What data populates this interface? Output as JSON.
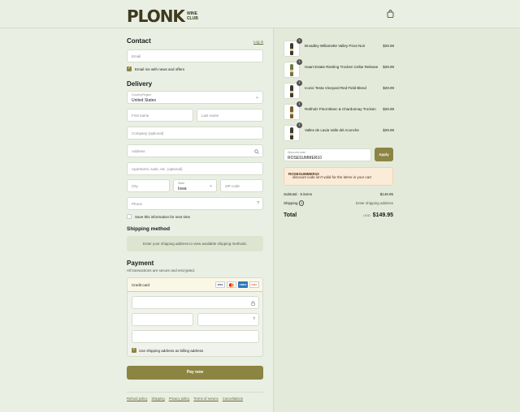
{
  "brand": {
    "logo_text": "PLONK",
    "logo_sub_line1": "WINE",
    "logo_sub_line2": "CLUB"
  },
  "contact": {
    "title": "Contact",
    "login_link": "Log in",
    "email_placeholder": "Email",
    "newsletter_label": "Email me with news and offers",
    "newsletter_checked": true
  },
  "delivery": {
    "title": "Delivery",
    "country_label": "Country/Region",
    "country_value": "United States",
    "first_name_placeholder": "First name",
    "last_name_placeholder": "Last name",
    "company_placeholder": "Company (optional)",
    "address_placeholder": "Address",
    "apartment_placeholder": "Apartment, suite, etc. (optional)",
    "city_placeholder": "City",
    "state_label": "State",
    "state_value": "Iowa",
    "zip_placeholder": "ZIP code",
    "phone_placeholder": "Phone",
    "save_info_label": "Save this information for next time",
    "save_info_checked": false
  },
  "shipping_method": {
    "title": "Shipping method",
    "message": "Enter your shipping address to view available shipping methods."
  },
  "payment": {
    "title": "Payment",
    "subtitle": "All transactions are secure and encrypted.",
    "method_label": "Credit card",
    "cards": [
      "VISA",
      "MC",
      "AMEX",
      "DISC"
    ],
    "billing_label": "Use shipping address as billing address",
    "billing_checked": true
  },
  "pay_button": "Pay now",
  "footer_links": [
    "Refund policy",
    "Shipping",
    "Privacy policy",
    "Terms of service",
    "Cancellations"
  ],
  "cart": {
    "items": [
      {
        "qty": "1",
        "name": "Broadley Willamette Valley Pinot Noir",
        "price": "$29.99"
      },
      {
        "qty": "1",
        "name": "Haart Estate Riesling Trocken Cellar Release",
        "price": "$29.99"
      },
      {
        "qty": "1",
        "name": "Iconic Testa Vineyard Red Field Blend",
        "price": "$29.99"
      },
      {
        "qty": "1",
        "name": "Rebholz Pinot Blanc & Chardonnay Trocken",
        "price": "$29.99"
      },
      {
        "qty": "1",
        "name": "Valles de Lavia Valle del Aconche",
        "price": "$29.99"
      }
    ],
    "discount_label": "Discount code",
    "discount_value": "ROSESUMMER10",
    "apply_label": "Apply",
    "warning_code": "ROSESUMMER10",
    "warning_text": " discount code isn't valid for the items in your cart",
    "subtotal_label": "Subtotal · 5 items",
    "subtotal_value": "$149.95",
    "shipping_label": "Shipping",
    "shipping_value": "Enter shipping address",
    "total_label": "Total",
    "total_currency": "USD",
    "total_value": "$149.95"
  },
  "colors": {
    "accent": "#8b8442",
    "background": "#e9efe3",
    "warning_bg": "#fbebd9"
  }
}
